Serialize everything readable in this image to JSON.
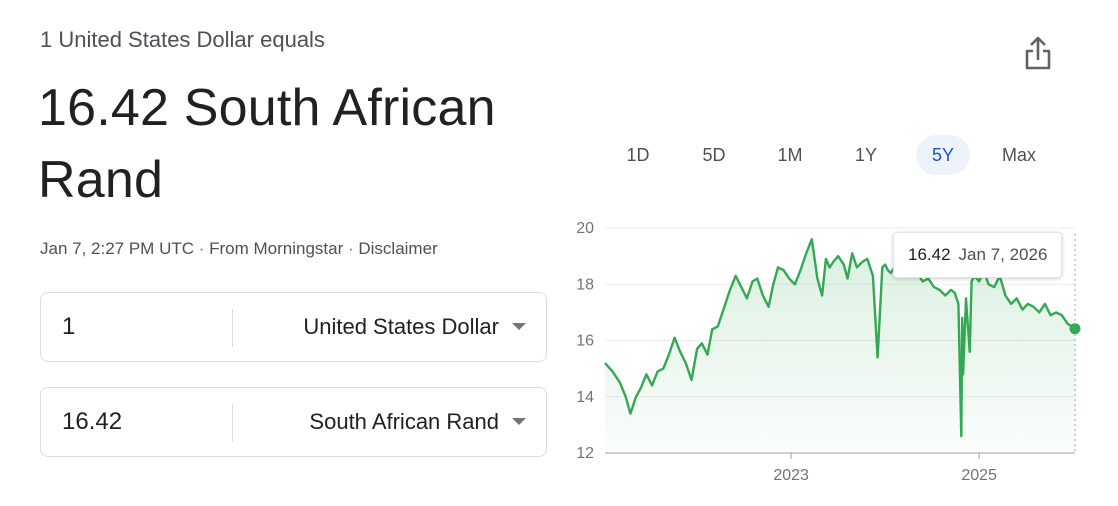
{
  "header": {
    "equals_text": "1 United States Dollar equals",
    "result_text": "16.42 South African Rand",
    "timestamp": "Jan 7, 2:27 PM UTC",
    "source": "From Morningstar",
    "disclaimer": "Disclaimer",
    "separator": " · "
  },
  "converter": {
    "from_amount": "1",
    "from_currency": "United States Dollar",
    "to_amount": "16.42",
    "to_currency": "South African Rand"
  },
  "range_tabs": [
    {
      "label": "1D",
      "active": false
    },
    {
      "label": "5D",
      "active": false
    },
    {
      "label": "1M",
      "active": false
    },
    {
      "label": "1Y",
      "active": false
    },
    {
      "label": "5Y",
      "active": true
    },
    {
      "label": "Max",
      "active": false
    }
  ],
  "tooltip": {
    "value": "16.42",
    "date": "Jan 7, 2026"
  },
  "icons": {
    "share": "share-icon",
    "caret": "caret-down-icon"
  },
  "colors": {
    "line": "#34a853",
    "active_tab_text": "#1a56b7",
    "active_tab_bg": "#eef3fb"
  },
  "chart_data": {
    "type": "area",
    "title": "",
    "xlabel": "",
    "ylabel": "",
    "ylim": [
      12,
      20
    ],
    "yticks": [
      12,
      14,
      16,
      18,
      20
    ],
    "xticks": [
      2023,
      2025
    ],
    "x_range": [
      2021.02,
      2026.02
    ],
    "grid": true,
    "x": [
      2021.02,
      2021.1,
      2021.18,
      2021.24,
      2021.29,
      2021.35,
      2021.4,
      2021.46,
      2021.52,
      2021.58,
      2021.64,
      2021.7,
      2021.76,
      2021.82,
      2021.88,
      2021.94,
      2022.0,
      2022.05,
      2022.11,
      2022.16,
      2022.22,
      2022.29,
      2022.35,
      2022.41,
      2022.47,
      2022.53,
      2022.59,
      2022.64,
      2022.7,
      2022.76,
      2022.81,
      2022.86,
      2022.92,
      2022.98,
      2023.04,
      2023.1,
      2023.16,
      2023.22,
      2023.28,
      2023.33,
      2023.37,
      2023.41,
      2023.45,
      2023.5,
      2023.56,
      2023.6,
      2023.65,
      2023.7,
      2023.76,
      2023.81,
      2023.87,
      2023.92,
      2023.97,
      2024.0,
      2024.03,
      2024.06,
      2024.1,
      2024.16,
      2024.22,
      2024.28,
      2024.34,
      2024.4,
      2024.46,
      2024.52,
      2024.58,
      2024.64,
      2024.7,
      2024.74,
      2024.78,
      2024.81,
      2024.82,
      2024.83,
      2024.86,
      2024.9,
      2024.92,
      2024.95,
      2025.0,
      2025.05,
      2025.1,
      2025.16,
      2025.22,
      2025.28,
      2025.34,
      2025.4,
      2025.46,
      2025.52,
      2025.58,
      2025.64,
      2025.7,
      2025.76,
      2025.82,
      2025.88,
      2025.94,
      2026.02
    ],
    "series": [
      {
        "values": [
          15.2,
          14.9,
          14.5,
          14.0,
          13.4,
          14.0,
          14.3,
          14.8,
          14.4,
          14.9,
          15.0,
          15.5,
          16.1,
          15.6,
          15.2,
          14.6,
          15.7,
          15.9,
          15.5,
          16.4,
          16.5,
          17.2,
          17.8,
          18.3,
          17.9,
          17.5,
          18.1,
          18.2,
          17.6,
          17.2,
          18.0,
          18.6,
          18.5,
          18.2,
          18.0,
          18.5,
          19.1,
          19.6,
          18.2,
          17.6,
          18.9,
          18.6,
          18.8,
          19.0,
          18.7,
          18.2,
          19.1,
          18.6,
          18.8,
          18.9,
          18.3,
          15.4,
          18.6,
          18.7,
          18.5,
          18.4,
          18.6,
          18.9,
          18.3,
          18.5,
          18.4,
          18.1,
          18.2,
          17.9,
          17.8,
          17.6,
          17.8,
          17.7,
          17.3,
          12.6,
          16.8,
          14.8,
          17.5,
          15.6,
          18.1,
          18.3,
          18.1,
          18.5,
          18.0,
          17.9,
          18.3,
          17.6,
          17.3,
          17.5,
          17.1,
          17.3,
          17.2,
          17.0,
          17.3,
          16.9,
          17.0,
          16.9,
          16.6,
          16.42
        ]
      }
    ]
  }
}
